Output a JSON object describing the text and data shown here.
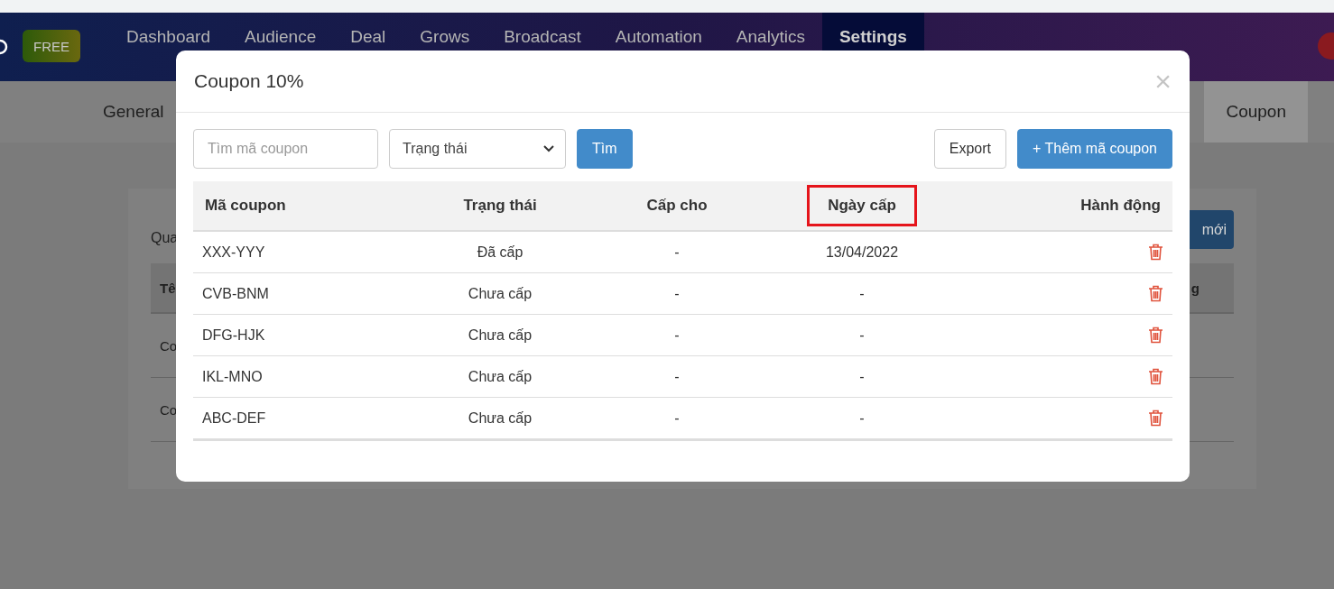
{
  "header": {
    "badge": "FREE",
    "nav": [
      {
        "label": "Dashboard",
        "selected": false
      },
      {
        "label": "Audience",
        "selected": false
      },
      {
        "label": "Deal",
        "selected": false
      },
      {
        "label": "Grows",
        "selected": false
      },
      {
        "label": "Broadcast",
        "selected": false
      },
      {
        "label": "Automation",
        "selected": false
      },
      {
        "label": "Analytics",
        "selected": false
      },
      {
        "label": "Settings",
        "selected": true
      }
    ]
  },
  "subnav": [
    {
      "label": "General",
      "selected": false
    },
    {
      "label": "Coupon",
      "selected": true
    }
  ],
  "background_card": {
    "title": "Qua",
    "button": "mới",
    "column_1": "Tê",
    "column_2": "g",
    "rows": [
      "Co",
      "Co"
    ]
  },
  "modal": {
    "title": "Coupon 10%",
    "close": "×",
    "search": {
      "placeholder": "Tìm mã coupon"
    },
    "status_select": {
      "value": "Trạng thái"
    },
    "search_button": "Tìm",
    "export_button": "Export",
    "add_button": "+ Thêm mã coupon",
    "table": {
      "columns": [
        {
          "label": "Mã coupon",
          "highlighted": false
        },
        {
          "label": "Trạng thái",
          "highlighted": false
        },
        {
          "label": "Cấp cho",
          "highlighted": false
        },
        {
          "label": "Ngày cấp",
          "highlighted": true
        },
        {
          "label": "Hành động",
          "highlighted": false
        }
      ],
      "rows": [
        {
          "code": "XXX-YYY",
          "status": "Đã cấp",
          "assigned_to": "-",
          "date": "13/04/2022"
        },
        {
          "code": "CVB-BNM",
          "status": "Chưa cấp",
          "assigned_to": "-",
          "date": "-"
        },
        {
          "code": "DFG-HJK",
          "status": "Chưa cấp",
          "assigned_to": "-",
          "date": "-"
        },
        {
          "code": "IKL-MNO",
          "status": "Chưa cấp",
          "assigned_to": "-",
          "date": "-"
        },
        {
          "code": "ABC-DEF",
          "status": "Chưa cấp",
          "assigned_to": "-",
          "date": "-"
        }
      ]
    }
  }
}
